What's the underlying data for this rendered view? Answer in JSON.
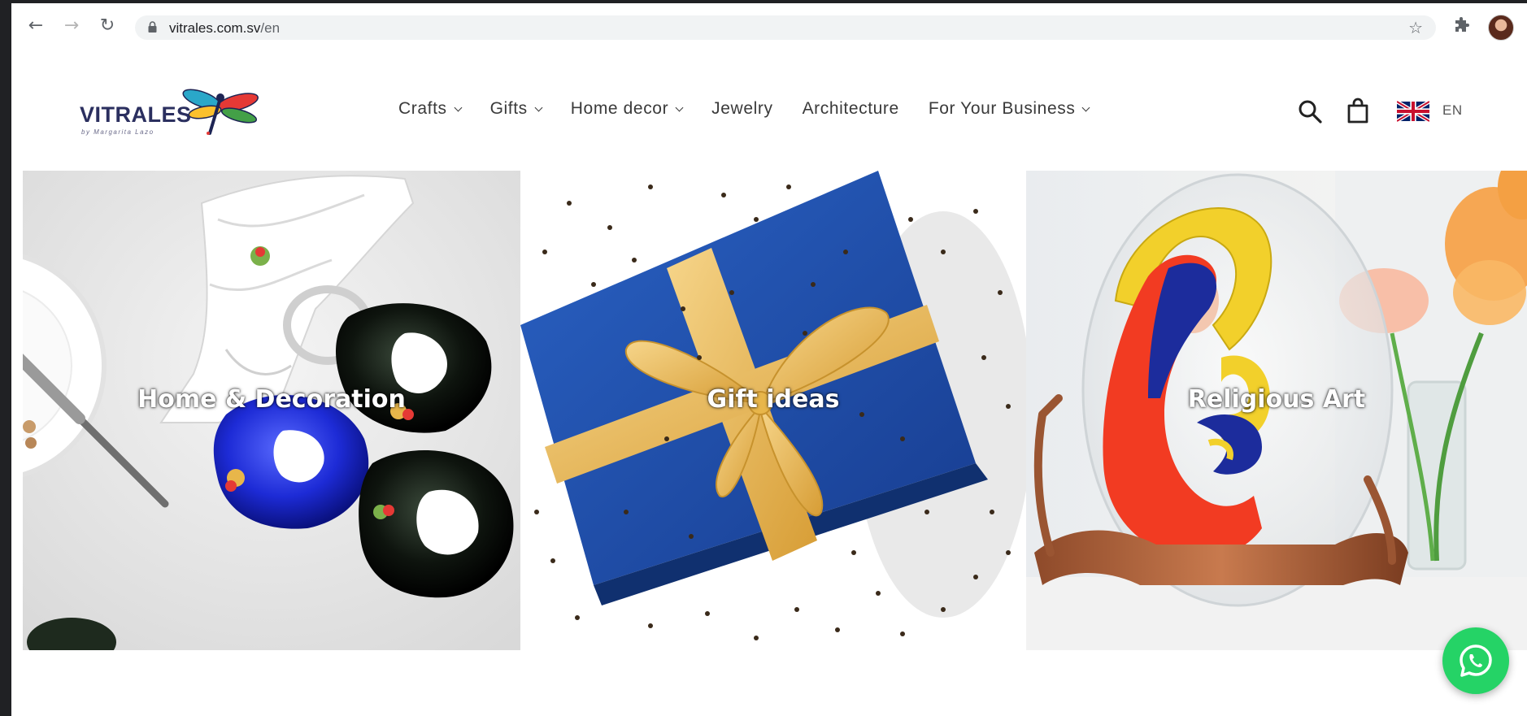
{
  "browser": {
    "url_host": "vitrales.com.sv",
    "url_path": "/en",
    "back_icon": "←",
    "forward_icon": "→",
    "reload_icon": "↻",
    "star_icon": "☆"
  },
  "site": {
    "logo_text": "VITRALES",
    "logo_subtext": "by Margarita Lazo",
    "nav": [
      {
        "label": "Crafts",
        "dropdown": true
      },
      {
        "label": "Gifts",
        "dropdown": true
      },
      {
        "label": "Home decor",
        "dropdown": true
      },
      {
        "label": "Jewelry",
        "dropdown": false
      },
      {
        "label": "Architecture",
        "dropdown": false
      },
      {
        "label": "For Your Business",
        "dropdown": true
      }
    ],
    "language": "EN"
  },
  "tiles": [
    {
      "label": "Home & Decoration"
    },
    {
      "label": "Gift ideas"
    },
    {
      "label": "Religious Art"
    }
  ],
  "colors": {
    "whatsapp": "#25d366",
    "gift_blue": "#1f4fa8",
    "ribbon_gold": "#e8b64a"
  }
}
